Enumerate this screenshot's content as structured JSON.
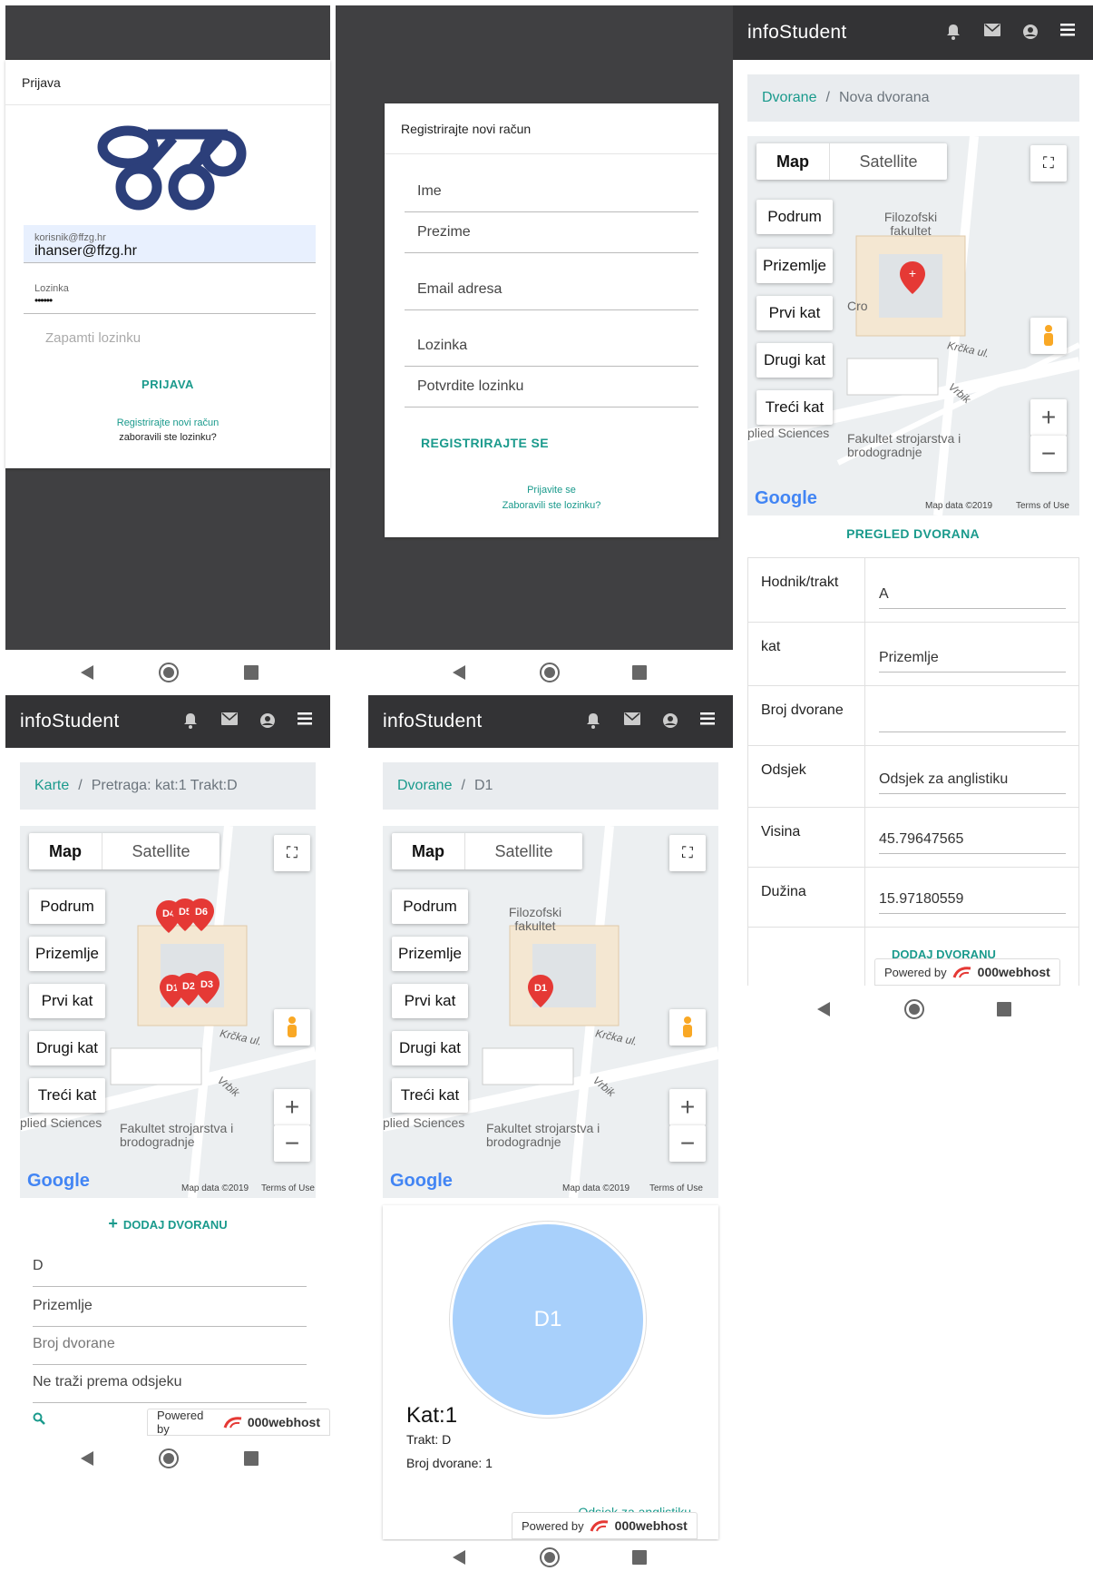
{
  "login": {
    "card_title": "Prijava",
    "email_label": "korisnik@ffzg.hr",
    "email_value": "ihanser@ffzg.hr",
    "password_label": "Lozinka",
    "password_value": "••••••",
    "remember_label": "Zapamti lozinku",
    "login_button": "PRIJAVA",
    "register_link": "Registrirajte novi račun",
    "forgot_link": "zaboravili ste lozinku?"
  },
  "register": {
    "card_title": "Registrirajte novi račun",
    "fields": [
      "Ime",
      "Prezime",
      "Email adresa",
      "Lozinka",
      "Potvrdite lozinku"
    ],
    "submit_button": "REGISTRIRAJTE SE",
    "login_link": "Prijavite se",
    "forgot_link": "Zaboravili ste lozinku?"
  },
  "app": {
    "title": "infoStudent"
  },
  "map": {
    "tab_map": "Map",
    "tab_satellite": "Satellite",
    "floors": [
      "Podrum",
      "Prizemlje",
      "Prvi kat",
      "Drugi kat",
      "Treći kat"
    ],
    "label_faculty": "Filozofski fakultet",
    "label_fsb": "Fakultet strojarstva i brodogradnje",
    "label_applied": "plied Sciences",
    "label_street": "Krčka ul.",
    "label_vrbik": "Vrbik",
    "label_cro": "Cro",
    "label_k": "K",
    "google": "Google",
    "map_data": "Map data ©2019",
    "terms": "Terms of Use",
    "zoom_in": "+",
    "zoom_out": "−"
  },
  "new_hall": {
    "crumb_root": "Dvorane",
    "crumb_current": "Nova dvorana",
    "overview_button": "PREGLED DVORANA",
    "rows": [
      {
        "label": "Hodnik/trakt",
        "value": "A"
      },
      {
        "label": "kat",
        "value": "Prizemlje"
      },
      {
        "label": "Broj dvorane",
        "value": ""
      },
      {
        "label": "Odsjek",
        "value": "Odsjek za anglistiku"
      },
      {
        "label": "Visina",
        "value": "45.79647565"
      },
      {
        "label": "Dužina",
        "value": "15.97180559"
      }
    ],
    "add_button": "DODAJ DVORANU"
  },
  "search": {
    "crumb_root": "Karte",
    "crumb_current": "Pretraga: kat:1 Trakt:D",
    "markers": [
      "D4",
      "D5",
      "D6",
      "D1",
      "D2",
      "D3"
    ],
    "add_button": "DODAJ DVORANU",
    "filter_tract": "D",
    "filter_floor": "Prizemlje",
    "filter_room_placeholder": "Broj dvorane",
    "filter_dept": "Ne traži prema odsjeku"
  },
  "detail": {
    "crumb_root": "Dvorane",
    "crumb_current": "D1",
    "marker": "D1",
    "circle_label": "D1",
    "floor": "Kat:1",
    "tract": "Trakt: D",
    "room": "Broj dvorane: 1",
    "dept": "Odsjek za anglistiku"
  },
  "powered": {
    "prefix": "Powered by",
    "brand": "000webhost"
  },
  "colors": {
    "teal": "#1a9a8c",
    "appbar": "#333335",
    "dark_bg": "#404042",
    "circle": "#a8d0fb",
    "marker": "#e53935"
  }
}
